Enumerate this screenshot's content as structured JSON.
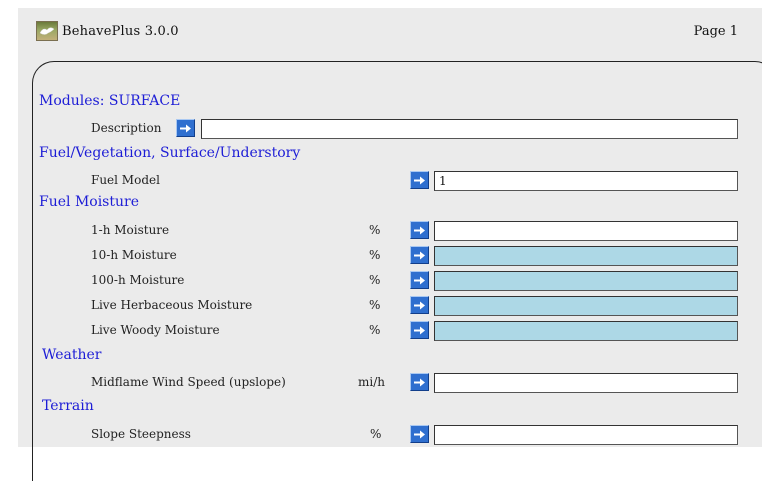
{
  "app": {
    "title": "BehavePlus 3.0.0",
    "page_label": "Page 1"
  },
  "modules": {
    "heading": "Modules: SURFACE",
    "description_label": "Description",
    "description_value": ""
  },
  "fuel_vegetation": {
    "heading": "Fuel/Vegetation, Surface/Understory",
    "fuel_model_label": "Fuel Model",
    "fuel_model_value": "1"
  },
  "fuel_moisture": {
    "heading": "Fuel Moisture",
    "rows": [
      {
        "label": "1-h Moisture",
        "unit": "%",
        "value": ""
      },
      {
        "label": "10-h Moisture",
        "unit": "%",
        "value": ""
      },
      {
        "label": "100-h Moisture",
        "unit": "%",
        "value": ""
      },
      {
        "label": "Live Herbaceous Moisture",
        "unit": "%",
        "value": ""
      },
      {
        "label": "Live Woody Moisture",
        "unit": "%",
        "value": ""
      }
    ]
  },
  "weather": {
    "heading": "Weather",
    "wind_label": "Midflame Wind Speed (upslope)",
    "wind_unit": "mi/h",
    "wind_value": ""
  },
  "terrain": {
    "heading": "Terrain",
    "slope_label": "Slope Steepness",
    "slope_unit": "%",
    "slope_value": ""
  },
  "colors": {
    "heading": "#1d1dd6",
    "button": "#2f6fcf",
    "disabled_field": "#add8e6",
    "panel": "#ebebeb"
  },
  "icons": {
    "app": "behaveplus-logo-icon",
    "arrow": "arrow-right-icon"
  }
}
